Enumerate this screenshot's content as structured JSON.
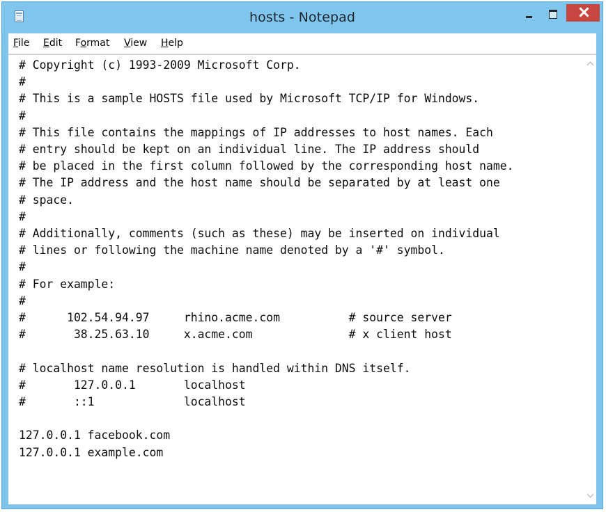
{
  "window": {
    "title": "hosts - Notepad"
  },
  "menu": [
    {
      "label": "File",
      "mnemonic": "F",
      "rest": "ile"
    },
    {
      "label": "Edit",
      "mnemonic": "E",
      "rest": "dit"
    },
    {
      "label": "Format",
      "pre": "F",
      "mnemonic": "o",
      "rest": "rmat"
    },
    {
      "label": "View",
      "mnemonic": "V",
      "rest": "iew"
    },
    {
      "label": "Help",
      "mnemonic": "H",
      "rest": "elp"
    }
  ],
  "document": {
    "content": "# Copyright (c) 1993-2009 Microsoft Corp.\n#\n# This is a sample HOSTS file used by Microsoft TCP/IP for Windows.\n#\n# This file contains the mappings of IP addresses to host names. Each\n# entry should be kept on an individual line. The IP address should\n# be placed in the first column followed by the corresponding host name.\n# The IP address and the host name should be separated by at least one\n# space.\n#\n# Additionally, comments (such as these) may be inserted on individual\n# lines or following the machine name denoted by a '#' symbol.\n#\n# For example:\n#\n#      102.54.94.97     rhino.acme.com          # source server\n#       38.25.63.10     x.acme.com              # x client host\n\n# localhost name resolution is handled within DNS itself.\n#       127.0.0.1       localhost\n#       ::1             localhost\n\n127.0.0.1 facebook.com\n127.0.0.1 example.com"
  },
  "colors": {
    "titlebar": "#80c6ec",
    "close_button": "#c7463f",
    "text": "#0b0b0b"
  }
}
